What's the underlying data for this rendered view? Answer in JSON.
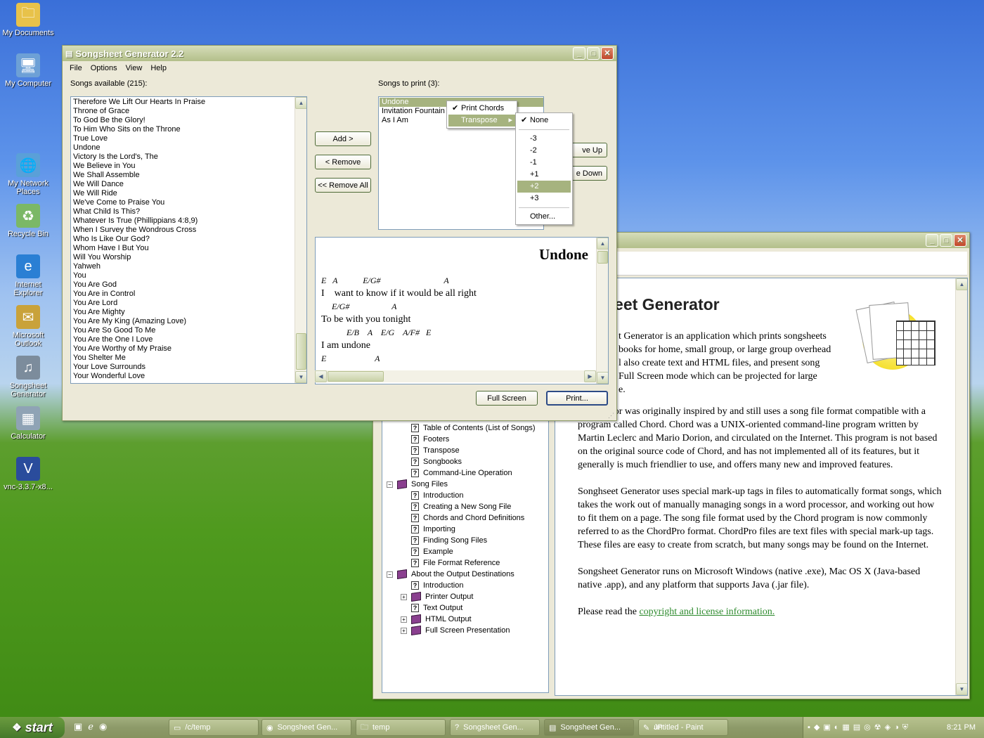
{
  "desktop_icons": [
    {
      "label": "My Documents",
      "icon": "folder-icon"
    },
    {
      "label": "My Computer",
      "icon": "computer-icon"
    },
    {
      "label": "My Network Places",
      "icon": "network-icon"
    },
    {
      "label": "Recycle Bin",
      "icon": "recycle-bin-icon"
    },
    {
      "label": "Internet Explorer",
      "icon": "ie-icon"
    },
    {
      "label": "Microsoft Outlook",
      "icon": "outlook-icon"
    },
    {
      "label": "Songsheet Generator",
      "icon": "songsheet-icon"
    },
    {
      "label": "Calculator",
      "icon": "calculator-icon"
    },
    {
      "label": "vnc-3.3.7-x8...",
      "icon": "vnc-icon"
    }
  ],
  "main_window": {
    "title": "Songsheet Generator 2.2",
    "menu": [
      "File",
      "Options",
      "View",
      "Help"
    ],
    "songs_available_label": "Songs available (215):",
    "songs_to_print_label": "Songs to print (3):",
    "songs_available": [
      "Therefore We Lift Our Hearts In Praise",
      "Throne of Grace",
      "To God Be the Glory!",
      "To Him Who Sits on the Throne",
      "True Love",
      "Undone",
      "Victory Is the Lord's, The",
      "We Believe in You",
      "We Shall Assemble",
      "We Will Dance",
      "We Will Ride",
      "We've Come to Praise You",
      "What Child Is This?",
      "Whatever Is True (Phillippians 4:8,9)",
      "When I Survey the Wondrous Cross",
      "Who Is Like Our God?",
      "Whom Have I But You",
      "Will You Worship",
      "Yahweh",
      "You",
      "You Are God",
      "You Are in Control",
      "You Are Lord",
      "You Are Mighty",
      "You Are My King (Amazing Love)",
      "You Are So Good To Me",
      "You Are the One I Love",
      "You Are Worthy of My Praise",
      "You Shelter Me",
      "Your Love Surrounds",
      "Your Wonderful Love"
    ],
    "songs_to_print": [
      "Undone",
      "Invitation Fountain",
      "As I Am"
    ],
    "buttons": {
      "add": "Add >",
      "remove": "< Remove",
      "remove_all": "<< Remove All",
      "move_up": "ve Up",
      "move_down": "e Down",
      "full_screen": "Full Screen",
      "print": "Print..."
    },
    "preview": {
      "title": "Undone",
      "lines": [
        {
          "type": "chord",
          "text": "E   A            E/G#                              A"
        },
        {
          "type": "lyric",
          "text": "I    want to know if it would be all right"
        },
        {
          "type": "chord",
          "text": "     E/G#                    A"
        },
        {
          "type": "lyric",
          "text": "To be with you tonight"
        },
        {
          "type": "chord",
          "text": "            E/B    A    E/G    A/F#   E"
        },
        {
          "type": "lyric",
          "text": "I am undone"
        },
        {
          "type": "chord",
          "text": "E                       A"
        }
      ]
    }
  },
  "context_menu": {
    "items": [
      {
        "label": "Print Chords",
        "checked": true
      },
      {
        "label": "Transpose",
        "submenu": true
      }
    ],
    "transpose_options": [
      {
        "label": "None",
        "checked": true
      },
      {
        "label": "-3"
      },
      {
        "label": "-2"
      },
      {
        "label": "-1"
      },
      {
        "label": "+1"
      },
      {
        "label": "+2",
        "highlighted": true
      },
      {
        "label": "+3"
      },
      {
        "label": "Other..."
      }
    ]
  },
  "help_window": {
    "heading": "heet Generator",
    "paragraphs": [
      "t Generator is an application which prints songsheets",
      "books for home, small group, or large group overhead",
      "l also create text and HTML files, and present song",
      "Full Screen mode which can be projected for large",
      "e."
    ],
    "body": [
      "t Generator was originally inspired by and still uses a song file format compatible with a program called Chord. Chord was a UNIX-oriented command-line program written by Martin Leclerc and Mario Dorion, and circulated on the Internet. This program is not based on the original source code of Chord, and has not implemented all of its features, but it generally is much friendlier to use, and offers many new and improved features.",
      "Songhseet Generator uses special mark-up tags in files to automatically format songs, which takes the work out of manually managing songs in a word processor, and working out how to fit them on a page. The song file format used by the Chord program is now commonly referred to as the ChordPro format. ChordPro files are text files with special mark-up tags. These files are easy to create from scratch, but many songs may be found on the Internet.",
      "Songsheet Generator runs on Microsoft Windows (native .exe), Mac OS X (Java-based native .app), and any platform that supports Java (.jar file)."
    ],
    "license_prefix": "Please read the ",
    "license_link": "copyright and license information.",
    "tree": [
      {
        "label": "Table of Contents (List of Songs)",
        "type": "page",
        "indent": 2
      },
      {
        "label": "Footers",
        "type": "page",
        "indent": 2
      },
      {
        "label": "Transpose",
        "type": "page",
        "indent": 2
      },
      {
        "label": "Songbooks",
        "type": "page",
        "indent": 2
      },
      {
        "label": "Command-Line Operation",
        "type": "page",
        "indent": 2
      },
      {
        "label": "Song Files",
        "type": "book-open",
        "indent": 1,
        "toggle": "−"
      },
      {
        "label": "Introduction",
        "type": "page",
        "indent": 2
      },
      {
        "label": "Creating a New Song File",
        "type": "page",
        "indent": 2
      },
      {
        "label": "Chords and Chord Definitions",
        "type": "page",
        "indent": 2
      },
      {
        "label": "Importing",
        "type": "page",
        "indent": 2
      },
      {
        "label": "Finding Song Files",
        "type": "page",
        "indent": 2
      },
      {
        "label": "Example",
        "type": "page",
        "indent": 2
      },
      {
        "label": "File Format Reference",
        "type": "page",
        "indent": 2
      },
      {
        "label": "About the Output Destinations",
        "type": "book-open",
        "indent": 1,
        "toggle": "−"
      },
      {
        "label": "Introduction",
        "type": "page",
        "indent": 2
      },
      {
        "label": "Printer Output",
        "type": "book",
        "indent": 2,
        "toggle": "+"
      },
      {
        "label": "Text Output",
        "type": "page",
        "indent": 2
      },
      {
        "label": "HTML Output",
        "type": "book",
        "indent": 2,
        "toggle": "+"
      },
      {
        "label": "Full Screen Presentation",
        "type": "book",
        "indent": 2,
        "toggle": "+"
      }
    ]
  },
  "taskbar": {
    "start": "start",
    "tasks": [
      "/c/temp",
      "Songsheet Gen...",
      "temp",
      "Songsheet Gen...",
      "Songsheet Gen...",
      "untitled - Paint"
    ],
    "lang": "JP",
    "clock": "8:21 PM"
  }
}
